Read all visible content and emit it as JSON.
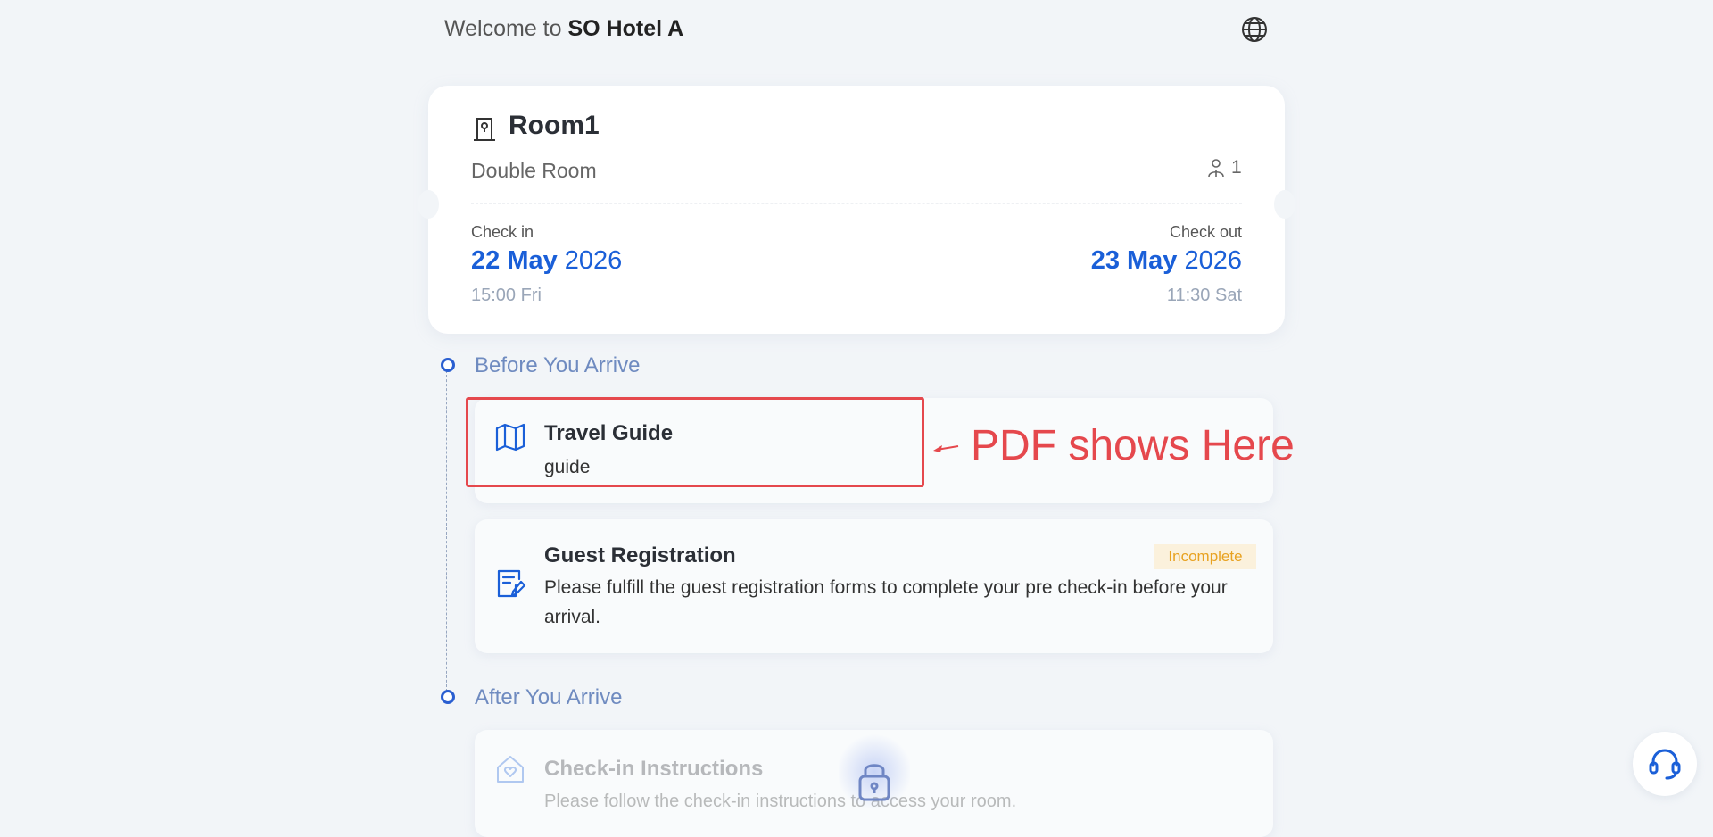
{
  "header": {
    "welcome_prefix": "Welcome to",
    "hotel_name": "SO Hotel A",
    "language_icon": "globe-icon"
  },
  "room": {
    "name": "Room1",
    "type": "Double Room",
    "guests": "1",
    "check_in": {
      "label": "Check in",
      "day_month": "22 May",
      "year": "2026",
      "time": "15:00 Fri"
    },
    "check_out": {
      "label": "Check out",
      "day_month": "23 May",
      "year": "2026",
      "time": "11:30 Sat"
    }
  },
  "sections": {
    "before": "Before You Arrive",
    "after": "After You Arrive"
  },
  "tasks": {
    "travel_guide": {
      "title": "Travel Guide",
      "desc": "guide",
      "icon": "map-icon"
    },
    "registration": {
      "title": "Guest Registration",
      "desc": "Please fulfill the guest registration forms to complete your pre check-in before your arrival.",
      "status": "Incomplete",
      "icon": "form-edit-icon"
    },
    "checkin_instructions": {
      "title": "Check-in Instructions",
      "desc": "Please follow the check-in instructions to access your room.",
      "icon": "house-heart-icon"
    }
  },
  "annotation": {
    "text": "PDF shows Here"
  },
  "colors": {
    "accent": "#1a5fd8",
    "annotation": "#e5484d",
    "badge_text": "#e8a221",
    "badge_bg": "#fbf1dc"
  }
}
